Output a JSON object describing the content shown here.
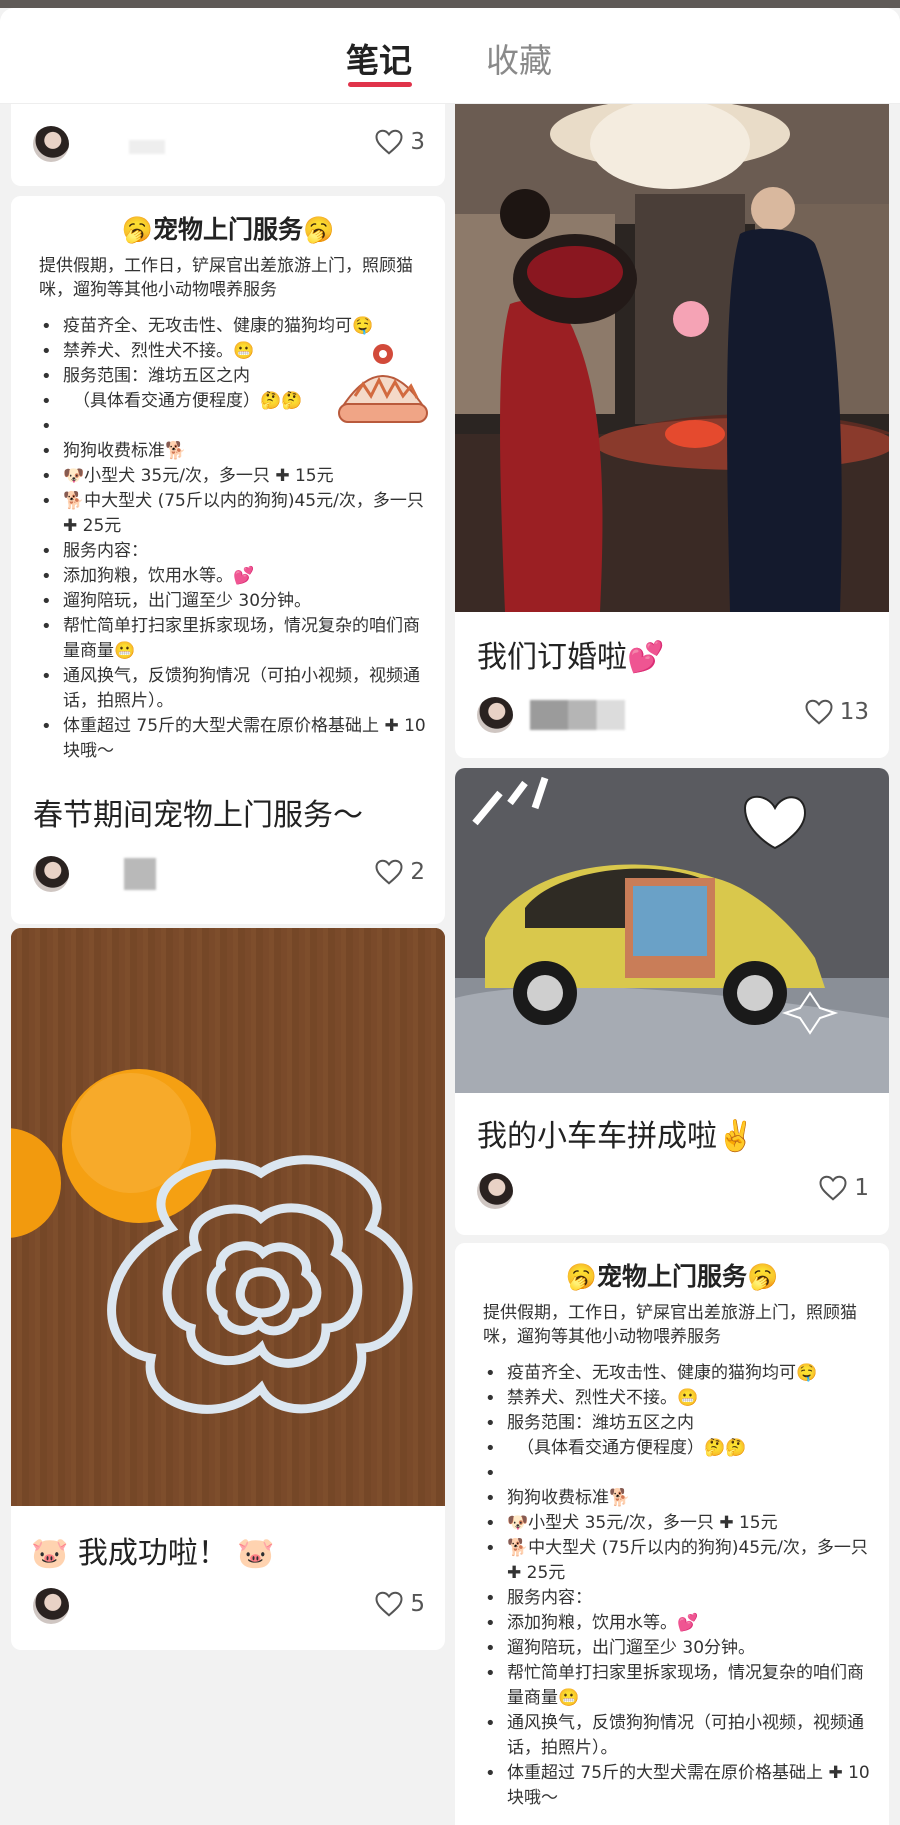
{
  "tabs": {
    "notes": "笔记",
    "favorites": "收藏"
  },
  "colors": {
    "accent": "#e0334a",
    "background": "#f2f2f2"
  },
  "cards": {
    "top_left": {
      "likes": "3"
    },
    "pet_service_left": {
      "poster": {
        "title": "🥱宠物上门服务🥱",
        "intro": "提供假期，工作日，铲屎官出差旅游上门，照顾猫咪，遛狗等其他小动物喂养服务",
        "items": [
          "疫苗齐全、无攻击性、健康的猫狗均可🤤",
          "禁养犬、烈性犬不接。😬",
          "服务范围：潍坊五区之内",
          "（具体看交通方便程度）🤔🤔",
          "",
          "狗狗收费标准🐕",
          "🐶小型犬 35元/次，多一只 ✚ 15元",
          "🐕中大型犬 (75斤以内的狗狗)45元/次，多一只 ✚ 25元",
          "服务内容：",
          "添加狗粮，饮用水等。💕",
          "遛狗陪玩，出门遛至少 30分钟。",
          "帮忙简单打扫家里拆家现场，情况复杂的咱们商量商量😬",
          "通风换气，反馈狗狗情况（可拍小视频，视频通话，拍照片）。",
          "体重超过 75斤的大型犬需在原价格基础上 ✚ 10块哦～"
        ]
      },
      "title": "春节期间宠物上门服务～",
      "likes": "2"
    },
    "engagement": {
      "title": "我们订婚啦💕",
      "likes": "13"
    },
    "car": {
      "title": "我的小车车拼成啦✌️",
      "likes": "1"
    },
    "paper_cut": {
      "title": "🐷 我成功啦！ 🐷",
      "likes": "5"
    },
    "pet_service_right": {
      "poster": {
        "title": "🥱宠物上门服务🥱",
        "intro": "提供假期，工作日，铲屎官出差旅游上门，照顾猫咪，遛狗等其他小动物喂养服务",
        "items": [
          "疫苗齐全、无攻击性、健康的猫狗均可🤤",
          "禁养犬、烈性犬不接。😬",
          "服务范围：潍坊五区之内",
          "（具体看交通方便程度）🤔🤔",
          "",
          "狗狗收费标准🐕",
          "🐶小型犬 35元/次，多一只 ✚ 15元",
          "🐕中大型犬 (75斤以内的狗狗)45元/次，多一只 ✚ 25元",
          "服务内容：",
          "添加狗粮，饮用水等。💕",
          "遛狗陪玩，出门遛至少 30分钟。",
          "帮忙简单打扫家里拆家现场，情况复杂的咱们商量商量😬",
          "通风换气，反馈狗狗情况（可拍小视频，视频通话，拍照片）。",
          "体重超过 75斤的大型犬需在原价格基础上 ✚ 10块哦～"
        ]
      }
    }
  }
}
